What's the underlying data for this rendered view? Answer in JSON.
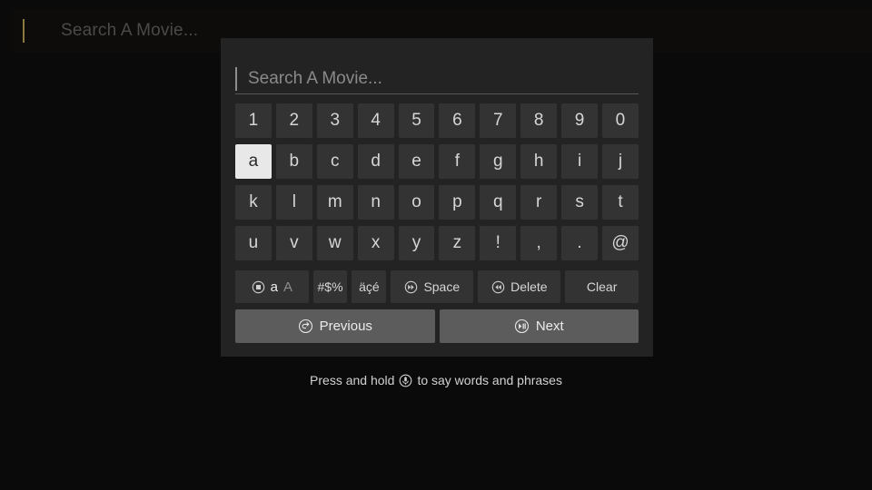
{
  "topbar": {
    "placeholder": "Search A Movie...",
    "cursor_color": "#8a7a3c"
  },
  "dialog": {
    "search": {
      "placeholder": "Search A Movie...",
      "value": ""
    },
    "key_rows": [
      [
        "1",
        "2",
        "3",
        "4",
        "5",
        "6",
        "7",
        "8",
        "9",
        "0"
      ],
      [
        "a",
        "b",
        "c",
        "d",
        "e",
        "f",
        "g",
        "h",
        "i",
        "j"
      ],
      [
        "k",
        "l",
        "m",
        "n",
        "o",
        "p",
        "q",
        "r",
        "s",
        "t"
      ],
      [
        "u",
        "v",
        "w",
        "x",
        "y",
        "z",
        "!",
        ",",
        ".",
        "@"
      ]
    ],
    "selected_key": "a",
    "function_keys": {
      "case_lower": "a",
      "case_upper": "A",
      "symbols": "#$%",
      "accents": "äçé",
      "space": "Space",
      "delete": "Delete",
      "clear": "Clear"
    },
    "nav": {
      "previous": "Previous",
      "next": "Next"
    }
  },
  "hint": {
    "before": "Press and hold",
    "after": "to say words and phrases"
  },
  "colors": {
    "page_bg": "#0a0a0a",
    "dialog_bg": "#232323",
    "key_bg": "#333333",
    "key_selected_bg": "#e8e8e8",
    "nav_bg": "#5c5c5c",
    "accent_gold": "#8a7a3c"
  }
}
